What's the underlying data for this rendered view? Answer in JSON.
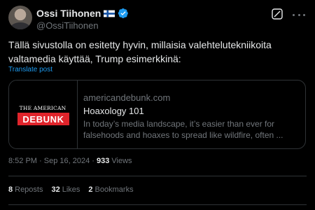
{
  "author": {
    "name": "Ossi Tiihonen",
    "handle": "@OssiTiihonen"
  },
  "post": {
    "text_line1": "Tällä sivustolla on esitetty hyvin, millaisia valehtelutekniikoita",
    "text_line2": "valtamedia käyttää, Trump esimerkkinä:",
    "translate_label": "Translate post"
  },
  "card": {
    "thumb_top": "THE AMERICAN",
    "thumb_box": "DEBUNK",
    "domain": "americandebunk.com",
    "title": "Hoaxology 101",
    "desc_line1": "In today’s media landscape, it’s easier than ever for",
    "desc_line2": "falsehoods and hoaxes to spread like wildfire, often ..."
  },
  "meta": {
    "time": "8:52 PM",
    "sep": " · ",
    "date": "Sep 16, 2024",
    "sep2": " · ",
    "views_count": "933",
    "views_label": " Views"
  },
  "stats": {
    "reposts_count": "8",
    "reposts_label": "Reposts",
    "likes_count": "32",
    "likes_label": "Likes",
    "bookmarks_count": "2",
    "bookmarks_label": "Bookmarks"
  },
  "colors": {
    "background": "#000000",
    "text": "#e7e9ea",
    "muted": "#71767b",
    "link": "#1d9bf0",
    "verified": "#1d9bf0",
    "brand_red": "#e0242b"
  },
  "icons": [
    "flag-finland-icon",
    "verified-badge-icon",
    "grok-icon",
    "more-options-icon"
  ]
}
